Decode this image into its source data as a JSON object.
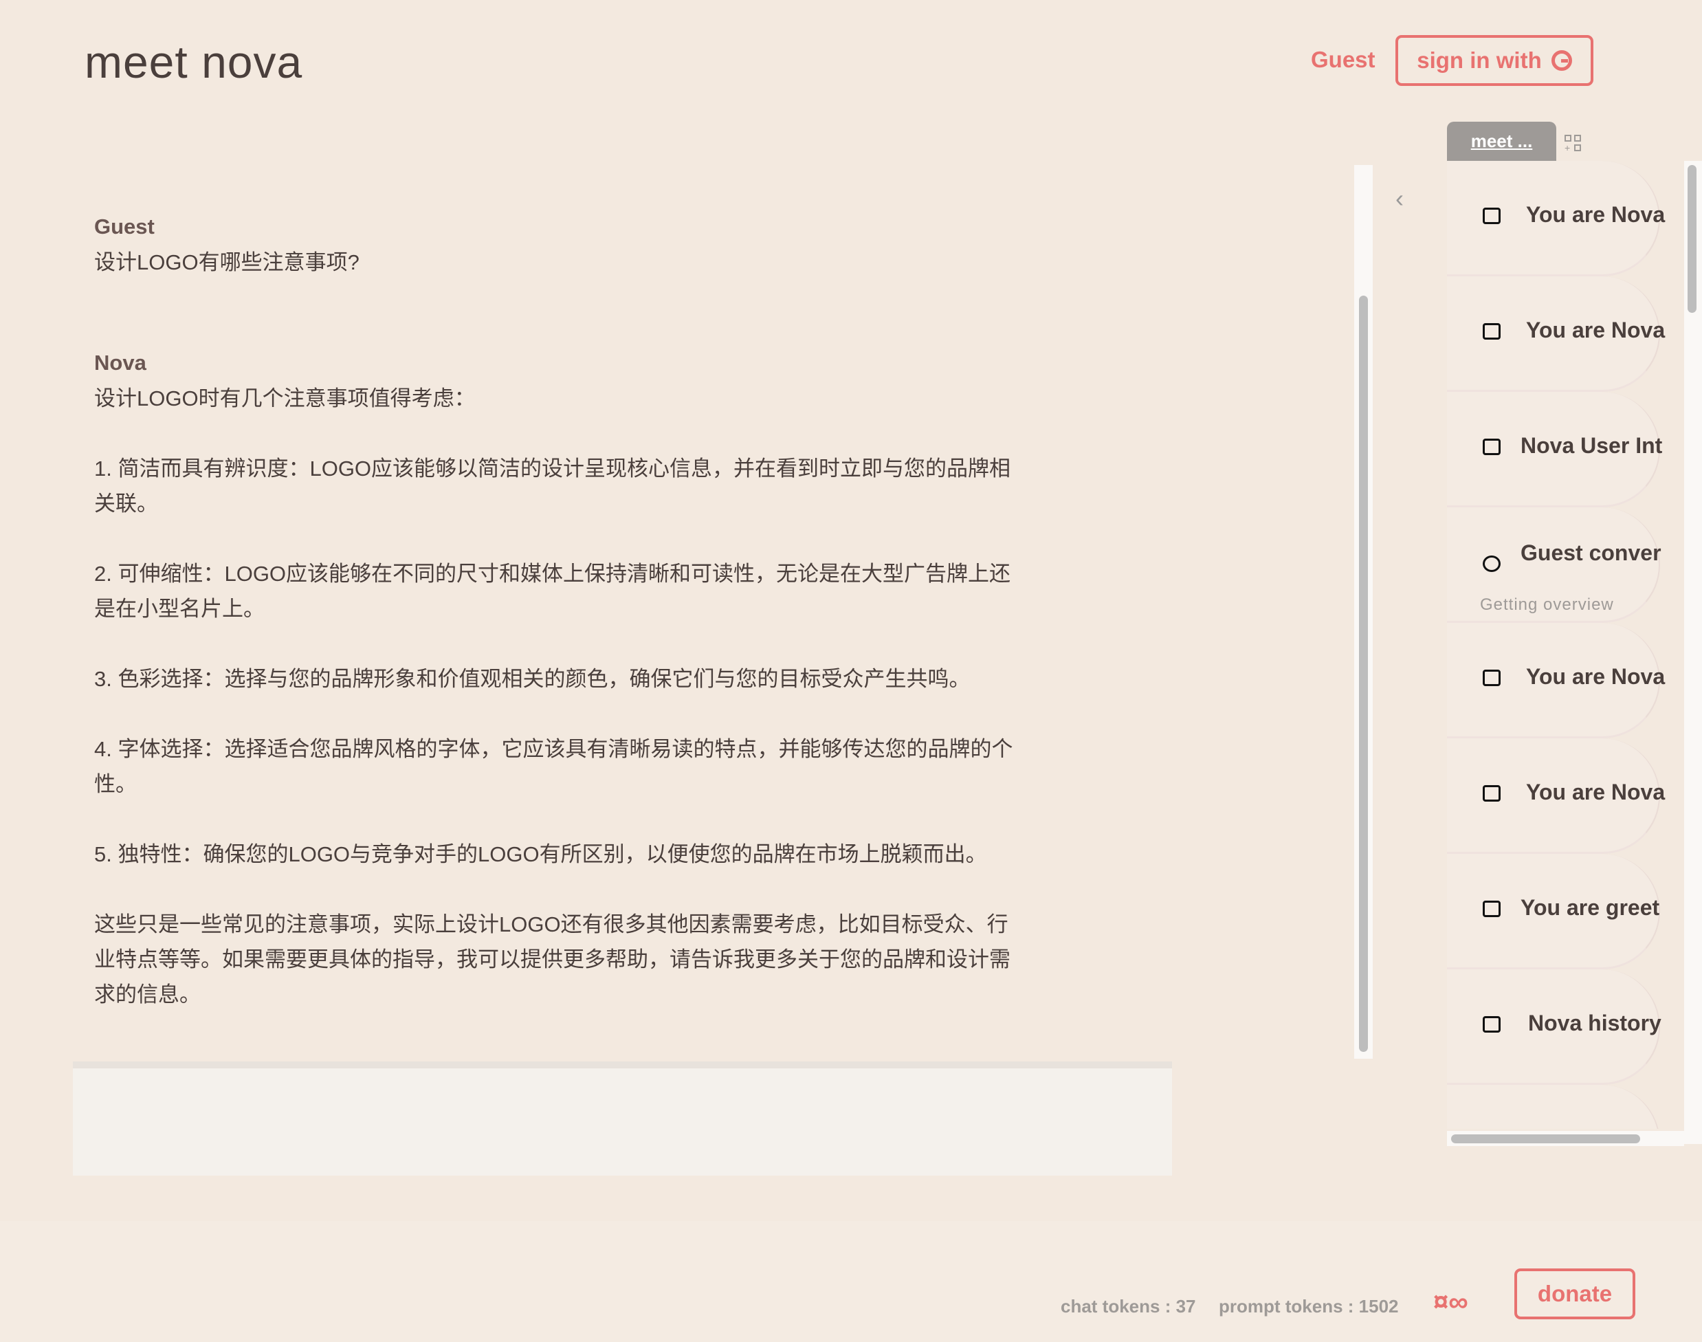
{
  "header": {
    "title": "meet nova",
    "user": "Guest",
    "sign_in_label": "sign in with"
  },
  "messages": [
    {
      "author": "Guest",
      "text": "设计LOGO有哪些注意事项?"
    },
    {
      "author": "Nova",
      "text": "设计LOGO时有几个注意事项值得考虑：\n\n1. 简洁而具有辨识度：LOGO应该能够以简洁的设计呈现核心信息，并在看到时立即与您的品牌相\n关联。\n\n2. 可伸缩性：LOGO应该能够在不同的尺寸和媒体上保持清晰和可读性，无论是在大型广告牌上还\n是在小型名片上。\n\n3. 色彩选择：选择与您的品牌形象和价值观相关的颜色，确保它们与您的目标受众产生共鸣。\n\n4. 字体选择：选择适合您品牌风格的字体，它应该具有清晰易读的特点，并能够传达您的品牌的个\n性。\n\n5. 独特性：确保您的LOGO与竞争对手的LOGO有所区别，以便使您的品牌在市场上脱颖而出。\n\n这些只是一些常见的注意事项，实际上设计LOGO还有很多其他因素需要考虑，比如目标受众、行\n业特点等等。如果需要更具体的指导，我可以提供更多帮助，请告诉我更多关于您的品牌和设计需\n求的信息。"
    }
  ],
  "input": {
    "value": ""
  },
  "sidebar": {
    "tab_label": "meet ...",
    "items": [
      {
        "label": "You are Nova",
        "icon": "scroll-icon"
      },
      {
        "label": "You are Nova",
        "icon": "scroll-icon"
      },
      {
        "label": "Nova User Int",
        "icon": "scroll-icon"
      },
      {
        "label": "Guest conver",
        "icon": "cloud-icon",
        "subtitle": "Getting overview"
      },
      {
        "label": "You are Nova",
        "icon": "scroll-icon"
      },
      {
        "label": "You are Nova",
        "icon": "scroll-icon"
      },
      {
        "label": "You are greet",
        "icon": "scroll-icon"
      },
      {
        "label": "Nova history",
        "icon": "scroll-icon"
      }
    ]
  },
  "footer": {
    "chat_tokens": "chat tokens : 37",
    "prompt_tokens": "prompt tokens : 1502",
    "credits_symbol": "¤∞",
    "donate_label": "donate"
  },
  "colors": {
    "accent": "#e87270",
    "background": "#f3e9df",
    "text": "#4a3f3c"
  }
}
